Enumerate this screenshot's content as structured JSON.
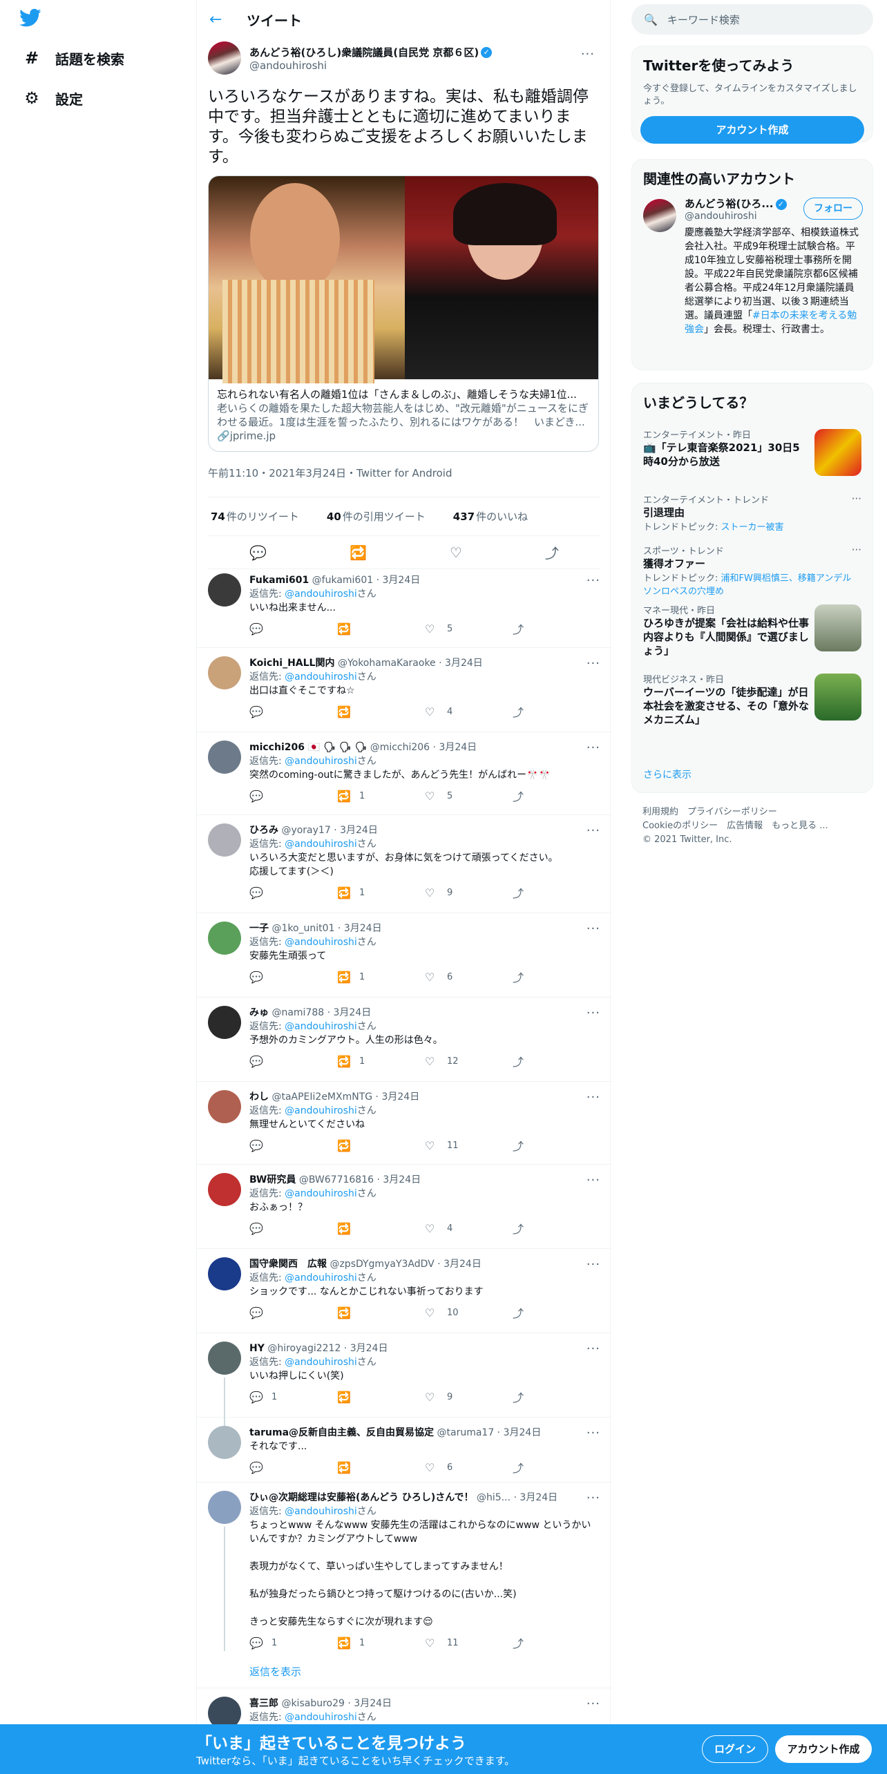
{
  "nav": {
    "explore": "話題を検索",
    "settings": "設定"
  },
  "header": {
    "title": "ツイート"
  },
  "main_tweet": {
    "name": "あんどう裕(ひろし)衆議院議員(自民党 京都６区)",
    "handle": "@andouhiroshi",
    "text": "いろいろなケースがありますね。実は、私も離婚調停中です。担当弁護士とともに適切に進めてまいります。今後も変わらぬご支援をよろしくお願いいたします。",
    "card_title": "忘れられない有名人の離婚1位は「さんま＆しのぶ」、離婚しそうな夫婦1位...",
    "card_desc": "老いらくの離婚を果たした超大物芸能人をはじめ、\"改元離婚\"がニュースをにぎわせる最近。1度は生涯を誓ったふたり、別れるにはワケがある！　いまどき...",
    "card_domain": "jprime.jp",
    "time": "午前11:10・2021年3月24日・Twitter for Android",
    "retweets": "74",
    "retweets_label": "件のリツイート",
    "quotes": "40",
    "quotes_label": "件の引用ツイート",
    "likes": "437",
    "likes_label": "件のいいね"
  },
  "replies": [
    {
      "name": "Fukami601",
      "handle": "@fukami601",
      "date": "3月24日",
      "to": "@andouhiroshi",
      "text": "いいね出来ません...",
      "rt": "",
      "like": "5",
      "reply": ""
    },
    {
      "name": "Koichi_HALL関内",
      "handle": "@YokohamaKaraoke",
      "date": "3月24日",
      "to": "@andouhiroshi",
      "text": "出口は直ぐそこですね☆",
      "rt": "",
      "like": "4",
      "reply": ""
    },
    {
      "name": "micchi206 🇯🇵 🗣 🗣 🗣",
      "handle": "@micchi206",
      "date": "3月24日",
      "to": "@andouhiroshi",
      "text": "突然のcoming-outに驚きましたが、あんどう先生！がんばれー🎌🎌",
      "rt": "1",
      "like": "5",
      "reply": ""
    },
    {
      "name": "ひろみ",
      "handle": "@yoray17",
      "date": "3月24日",
      "to": "@andouhiroshi",
      "text": "いろいろ大変だと思いますが、お身体に気をつけて頑張ってください。\n応援してます(＞＜)",
      "rt": "1",
      "like": "9",
      "reply": ""
    },
    {
      "name": "一子",
      "handle": "@1ko_unit01",
      "date": "3月24日",
      "to": "@andouhiroshi",
      "text": "安藤先生頑張って",
      "rt": "1",
      "like": "6",
      "reply": ""
    },
    {
      "name": "みゅ",
      "handle": "@nami788",
      "date": "3月24日",
      "to": "@andouhiroshi",
      "text": "予想外のカミングアウト。人生の形は色々。",
      "rt": "1",
      "like": "12",
      "reply": ""
    },
    {
      "name": "わし",
      "handle": "@taAPEIi2eMXmNTG",
      "date": "3月24日",
      "to": "@andouhiroshi",
      "text": "無理せんといてくださいね",
      "rt": "",
      "like": "11",
      "reply": ""
    },
    {
      "name": "BW研究員",
      "handle": "@BW67716816",
      "date": "3月24日",
      "to": "@andouhiroshi",
      "text": "おふぁっ！？",
      "rt": "",
      "like": "4",
      "reply": ""
    },
    {
      "name": "国守衆関西　広報",
      "handle": "@zpsDYgmyaY3AdDV",
      "date": "3月24日",
      "to": "@andouhiroshi",
      "text": "ショックです... なんとかこじれない事祈っております",
      "rt": "",
      "like": "10",
      "reply": ""
    },
    {
      "name": "HY",
      "handle": "@hiroyagi2212",
      "date": "3月24日",
      "to": "@andouhiroshi",
      "text": "いいね押しにくい(笑)",
      "rt": "",
      "like": "9",
      "reply": "1"
    },
    {
      "name": "taruma@反新自由主義、反自由貿易協定",
      "handle": "@taruma17",
      "date": "3月24日",
      "to": "",
      "text": "それなです...",
      "rt": "",
      "like": "6",
      "reply": ""
    },
    {
      "name": "ひぃ@次期総理は安藤裕(あんどう ひろし)さんで！",
      "handle": "@hi5...",
      "date": "3月24日",
      "to": "@andouhiroshi",
      "text": "ちょっとwww そんなwww 安藤先生の活躍はこれからなのにwww というかいいんですか？カミングアウトしてwww\n\n表現力がなくて、草いっぱい生やしてしまってすみません！\n\n私が独身だったら鍋ひとつ持って駆けつけるのに(古いか...笑)\n\nきっと安藤先生ならすぐに次が現れます😌",
      "rt": "1",
      "like": "11",
      "reply": "1"
    },
    {
      "name": "喜三郎",
      "handle": "@kisaburo29",
      "date": "3月24日",
      "to": "@andouhiroshi",
      "text": "",
      "rt": "",
      "like": "",
      "reply": ""
    }
  ],
  "reply_prefix": "返信先: ",
  "reply_suffix": "さん",
  "show_replies": "返信を表示",
  "right": {
    "search_placeholder": "キーワード検索",
    "signup_title": "Twitterを使ってみよう",
    "signup_desc": "今すぐ登録して、タイムラインをカスタマイズしましょう。",
    "signup_button": "アカウント作成",
    "relevant_title": "関連性の高いアカウント",
    "rel_name": "あんどう裕(ひろ...",
    "rel_handle": "@andouhiroshi",
    "rel_follow": "フォロー",
    "rel_bio_1": "慶應義塾大学経済学部卒、相模鉄道株式会社入社。平成9年税理士試験合格。平成10年独立し安藤裕税理士事務所を開設。平成22年自民党衆議院京都6区候補者公募合格。平成24年12月衆議院議員総選挙により初当選、以後３期連続当選。議員連盟「",
    "rel_bio_link": "#日本の未来を考える勉強会",
    "rel_bio_2": "」会長。税理士、行政書士。",
    "trends_title": "いまどうしてる？",
    "trends": [
      {
        "cat": "エンターテイメント・昨日",
        "title": "📺「テレ東音楽祭2021」30日5時40分から放送",
        "sub": ""
      },
      {
        "cat": "エンターテイメント・トレンド",
        "title": "引退理由",
        "sub_label": "トレンドトピック: ",
        "sub": "ストーカー被害"
      },
      {
        "cat": "スポーツ・トレンド",
        "title": "獲得オファー",
        "sub_label": "トレンドトピック: ",
        "sub": "浦和FW興梠慎三、移籍アンデルソンロペスの穴埋め"
      },
      {
        "cat": "マネー現代・昨日",
        "title": "ひろゆきが提案「会社は給料や仕事内容よりも『人間関係』で選びましょう」",
        "sub": ""
      },
      {
        "cat": "現代ビジネス・昨日",
        "title": "ウーバーイーツの「徒歩配達」が日本社会を激変させる、その「意外なメカニズム」",
        "sub": ""
      }
    ],
    "show_more": "さらに表示",
    "footer1": "利用規約　プライバシーポリシー",
    "footer2": "Cookieのポリシー　広告情報　もっと見る ...",
    "footer3": "© 2021 Twitter, Inc."
  },
  "bottom": {
    "headline": "「いま」起きていることを見つけよう",
    "sub": "Twitterなら、「いま」起きていることをいち早くチェックできます。",
    "login": "ログイン",
    "signup": "アカウント作成"
  },
  "colors": {
    "accent": "#1d9bf0",
    "text": "#0f1419",
    "secondary": "#536471"
  }
}
